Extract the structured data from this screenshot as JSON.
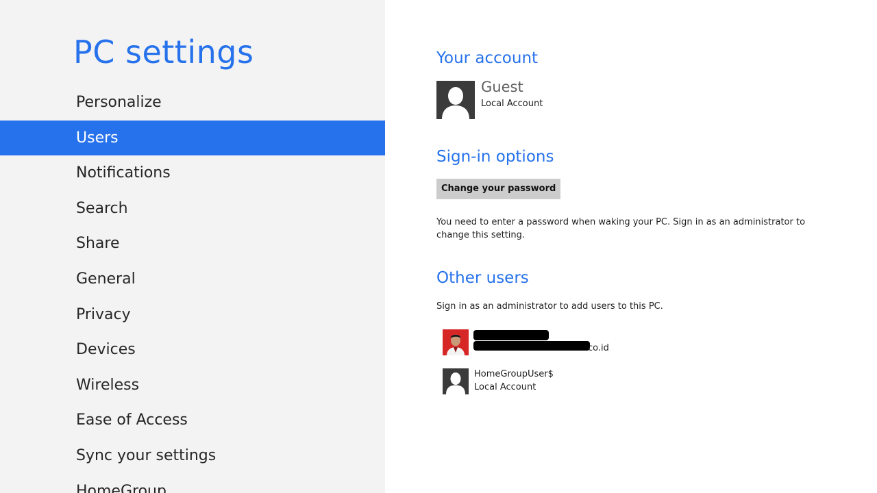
{
  "app": {
    "title": "PC settings",
    "accent_color": "#2672ec",
    "left_pane_color": "#f3f3f3"
  },
  "nav": {
    "selected": "Users",
    "items": [
      {
        "label": "Personalize"
      },
      {
        "label": "Users"
      },
      {
        "label": "Notifications"
      },
      {
        "label": "Search"
      },
      {
        "label": "Share"
      },
      {
        "label": "General"
      },
      {
        "label": "Privacy"
      },
      {
        "label": "Devices"
      },
      {
        "label": "Wireless"
      },
      {
        "label": "Ease of Access"
      },
      {
        "label": "Sync your settings"
      },
      {
        "label": "HomeGroup"
      }
    ]
  },
  "your_account": {
    "heading": "Your account",
    "name": "Guest",
    "type": "Local Account",
    "avatar_icon": "user-silhouette-icon"
  },
  "sign_in": {
    "heading": "Sign-in options",
    "change_password_label": "Change your password",
    "note": "You need to enter a password when waking your PC. Sign in as an administrator to change this setting."
  },
  "other_users": {
    "heading": "Other users",
    "note": "Sign in as an administrator to add users to this PC.",
    "users": [
      {
        "name": "",
        "subtitle": "co.id",
        "redacted": true,
        "avatar_icon": "user-photo-icon"
      },
      {
        "name": "HomeGroupUser$",
        "subtitle": "Local Account",
        "redacted": false,
        "avatar_icon": "user-silhouette-icon"
      }
    ]
  }
}
